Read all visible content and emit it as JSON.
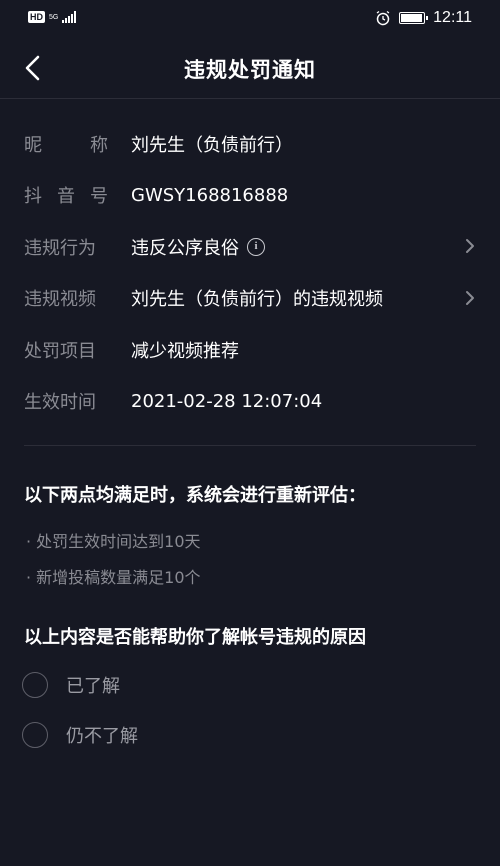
{
  "status_bar": {
    "left_badge": "HD",
    "network": "5G",
    "time": "12:11"
  },
  "header": {
    "title": "违规处罚通知"
  },
  "rows": [
    {
      "label": "昵称",
      "value": "刘先生（负债前行）"
    },
    {
      "label": "抖音号",
      "value": "GWSY168816888"
    },
    {
      "label": "违规行为",
      "value": "违反公序良俗"
    },
    {
      "label": "违规视频",
      "value": "刘先生（负债前行）的违规视频"
    },
    {
      "label": "处罚项目",
      "value": "减少视频推荐"
    },
    {
      "label": "生效时间",
      "value": "2021-02-28 12:07:04"
    }
  ],
  "reevaluation": {
    "heading": "以下两点均满足时，系统会进行重新评估：",
    "items": [
      "· 处罚生效时间达到10天",
      "· 新增投稿数量满足10个"
    ]
  },
  "feedback": {
    "question": "以上内容是否能帮助你了解帐号违规的原因",
    "options": [
      "已了解",
      "仍不了解"
    ]
  },
  "icons": {
    "back": "chevron-left-icon",
    "info": "info-icon",
    "chevron": "chevron-right-icon"
  },
  "colors": {
    "background": "#161823",
    "label": "#8a8b93",
    "text": "#ffffff"
  }
}
